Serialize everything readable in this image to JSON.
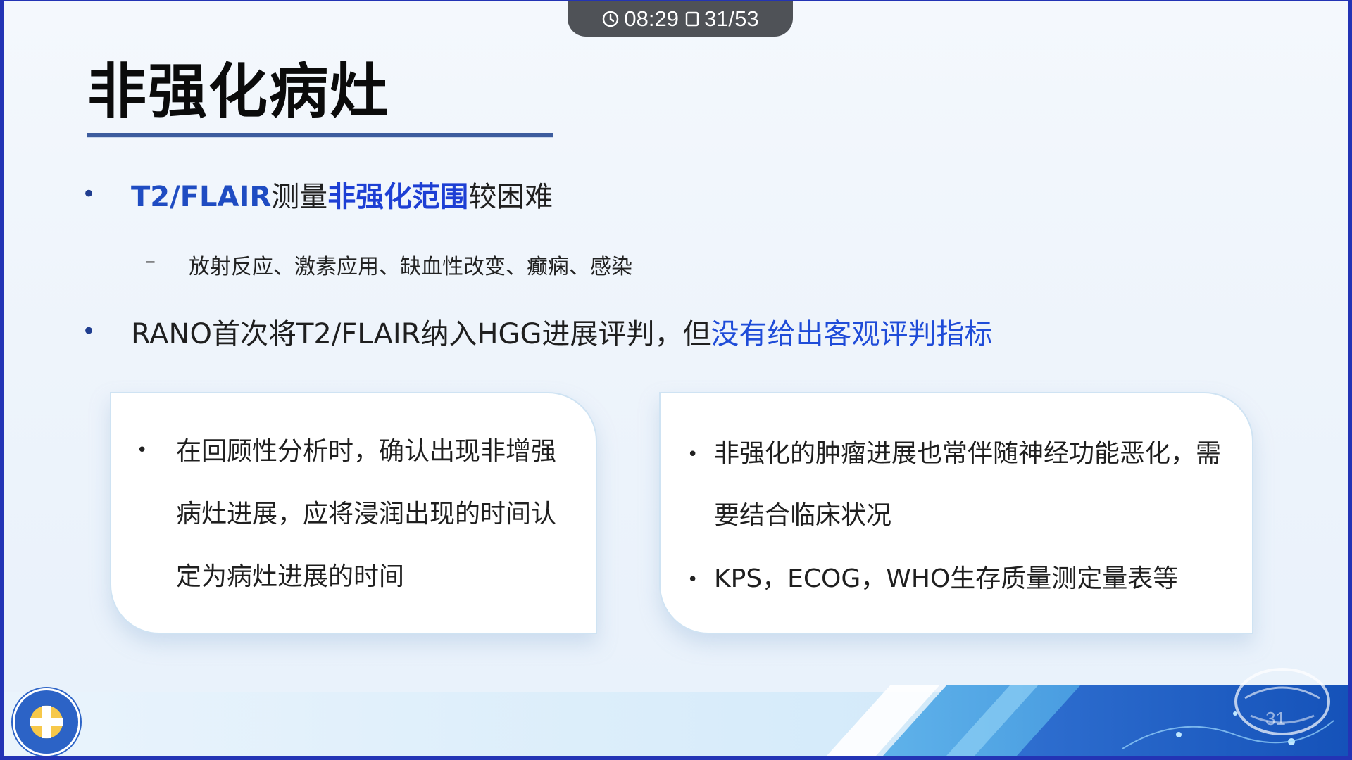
{
  "status_bar": {
    "time": "08:29",
    "page": "31/53"
  },
  "slide": {
    "title": "非强化病灶",
    "bullet1": {
      "prefix": "T2/FLAIR",
      "mid": "测量",
      "highlight": "非强化范围",
      "suffix": "较困难"
    },
    "sub_bullet": "放射反应、激素应用、缺血性改变、癫痫、感染",
    "bullet2": {
      "text": "RANO首次将T2/FLAIR纳入HGG进展评判，但",
      "highlight": "没有给出客观评判指标"
    },
    "card_left": {
      "item1": "在回顾性分析时，确认出现非增强病灶进展，应将浸润出现的时间认定为病灶进展的时间"
    },
    "card_right": {
      "item1": "非强化的肿瘤进展也常伴随神经功能恶化，需要结合临床状况",
      "item2": "KPS，ECOG，WHO生存质量测定量表等"
    },
    "page_number": "31"
  },
  "icons": {
    "clock": "clock-icon",
    "slides": "slides-icon",
    "logo": "hospital-logo",
    "watermark": "brainmed-watermark"
  }
}
